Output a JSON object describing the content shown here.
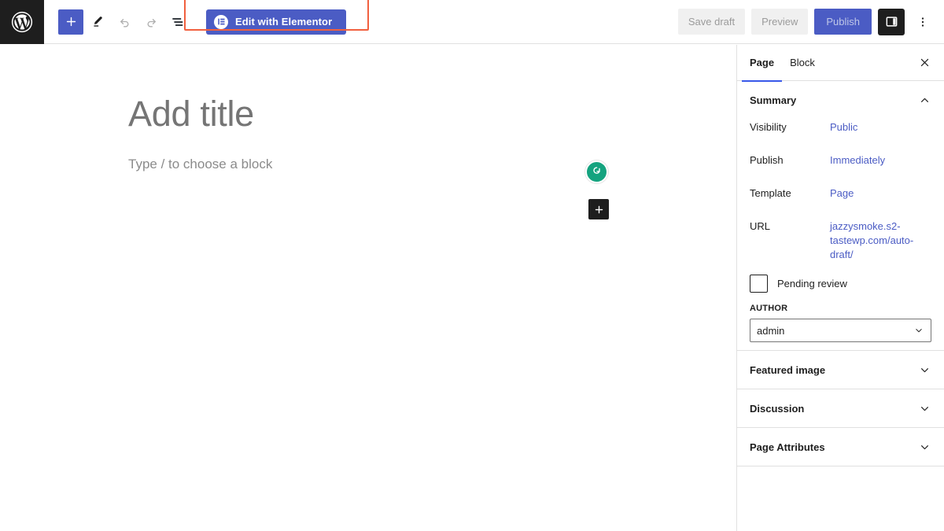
{
  "app": {
    "name": "WordPress Block Editor"
  },
  "header": {
    "logo_icon": "wordpress-logo-icon",
    "tools": [
      {
        "name": "block-inserter",
        "icon": "plus-icon",
        "label": "Toggle block inserter",
        "state": "primary"
      },
      {
        "name": "tools-pencil",
        "icon": "pencil-icon",
        "label": "Tools",
        "state": "active"
      },
      {
        "name": "undo",
        "icon": "undo-icon",
        "label": "Undo",
        "state": "disabled"
      },
      {
        "name": "redo",
        "icon": "redo-icon",
        "label": "Redo",
        "state": "disabled"
      },
      {
        "name": "document-overview",
        "icon": "list-view-icon",
        "label": "Document Overview",
        "state": "normal"
      }
    ],
    "elementor": {
      "label": "Edit with Elementor",
      "icon": "elementor-logo-icon",
      "bg_color": "#4b5cc4",
      "highlight_color": "#f1603f"
    },
    "save_draft_label": "Save draft",
    "preview_label": "Preview",
    "publish_label": "Publish",
    "settings_toggle_icon": "sidebar-panel-icon",
    "options_icon": "three-dots-vertical-icon"
  },
  "canvas": {
    "title_placeholder": "Add title",
    "block_placeholder": "Type / to choose a block",
    "grammarly_icon": "grammarly-icon",
    "grammarly_color": "#15a37f",
    "add_block_icon": "plus-icon"
  },
  "sidebar": {
    "tabs": [
      {
        "label": "Page",
        "active": true
      },
      {
        "label": "Block",
        "active": false
      }
    ],
    "close_icon": "close-icon",
    "summary": {
      "title": "Summary",
      "collapse_icon": "chevron-up-icon",
      "rows": [
        {
          "label": "Visibility",
          "value": "Public"
        },
        {
          "label": "Publish",
          "value": "Immediately"
        },
        {
          "label": "Template",
          "value": "Page"
        },
        {
          "label": "URL",
          "value": "jazzysmoke.s2-tastewp.com/auto-draft/"
        }
      ],
      "pending_review_label": "Pending review",
      "pending_review_checked": false,
      "author_label": "AUTHOR",
      "author_value": "admin",
      "author_chevron_icon": "chevron-down-icon"
    },
    "panels": [
      {
        "label": "Featured image",
        "icon": "chevron-down-icon"
      },
      {
        "label": "Discussion",
        "icon": "chevron-down-icon"
      },
      {
        "label": "Page Attributes",
        "icon": "chevron-down-icon"
      }
    ]
  }
}
